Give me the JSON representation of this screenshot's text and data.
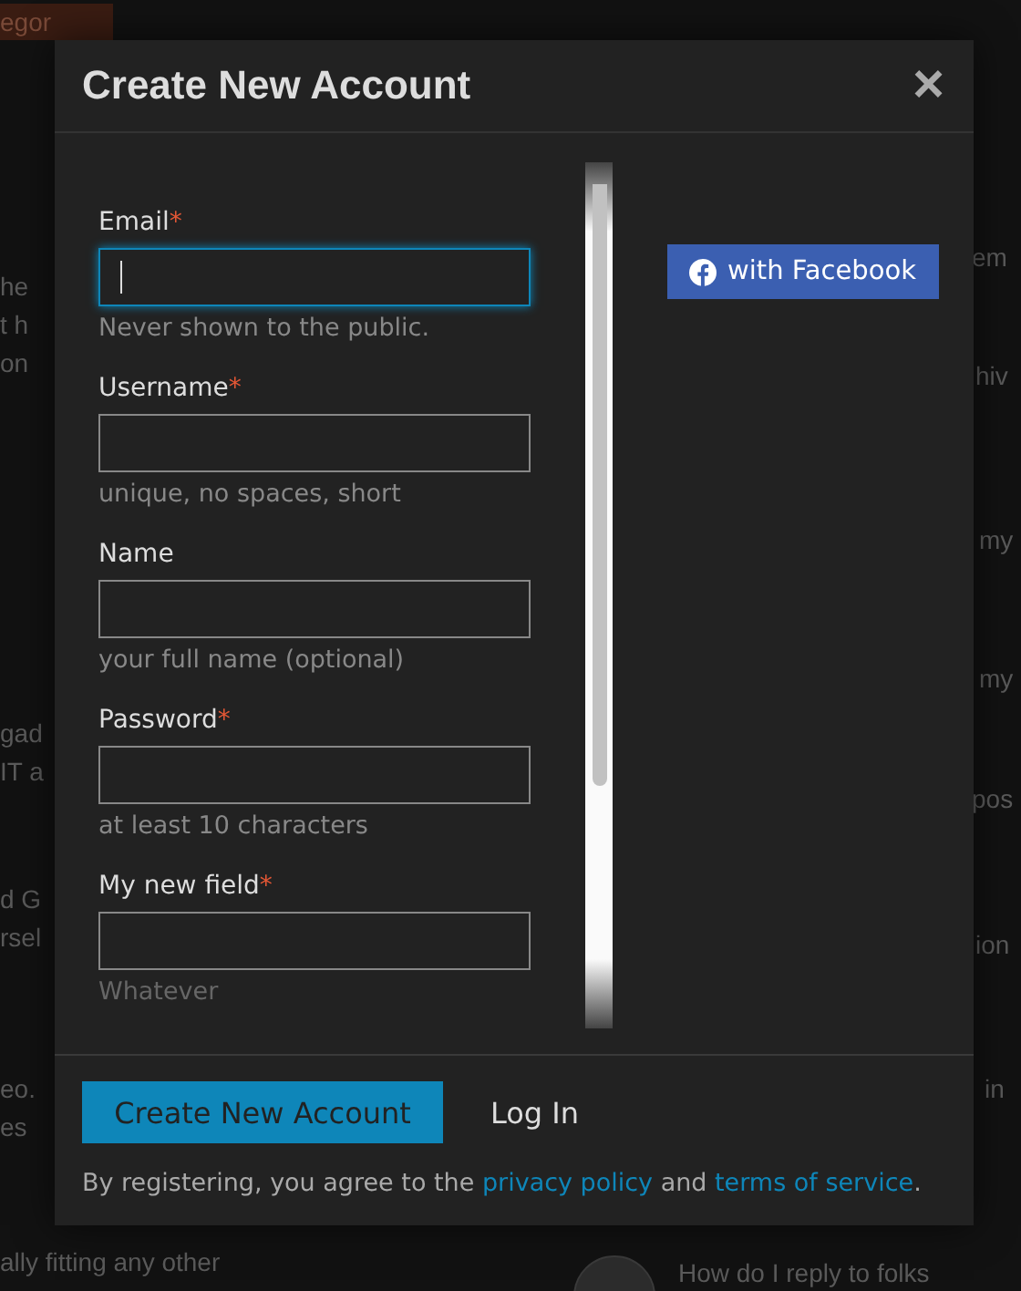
{
  "background": {
    "tag": "egor",
    "left_texts": [
      "he",
      "t h",
      "on",
      "gad",
      "IT a",
      "d G",
      "rsel",
      "eo.",
      "es",
      "ally fitting any other"
    ],
    "right_texts": [
      "em",
      "hiv",
      "my",
      "my",
      "pos",
      "ion",
      "in",
      "How do I reply to folks"
    ]
  },
  "dialog": {
    "title": "Create New Account",
    "close": "×",
    "fields": [
      {
        "label": "Email",
        "required": true,
        "hint": "Never shown to the public.",
        "focused": true
      },
      {
        "label": "Username",
        "required": true,
        "hint": "unique, no spaces, short",
        "focused": false
      },
      {
        "label": "Name",
        "required": false,
        "hint": "your full name (optional)",
        "focused": false
      },
      {
        "label": "Password",
        "required": true,
        "hint": "at least 10 characters",
        "focused": false
      },
      {
        "label": "My new field",
        "required": true,
        "hint": "Whatever",
        "focused": false
      }
    ],
    "required_mark": "*",
    "social_button": "with Facebook",
    "primary_button": "Create New Account",
    "secondary_button": "Log In",
    "terms": {
      "before": "By registering, you agree to the",
      "link1": "privacy policy",
      "middle": "and",
      "link2": "terms of service",
      "after": "."
    }
  }
}
